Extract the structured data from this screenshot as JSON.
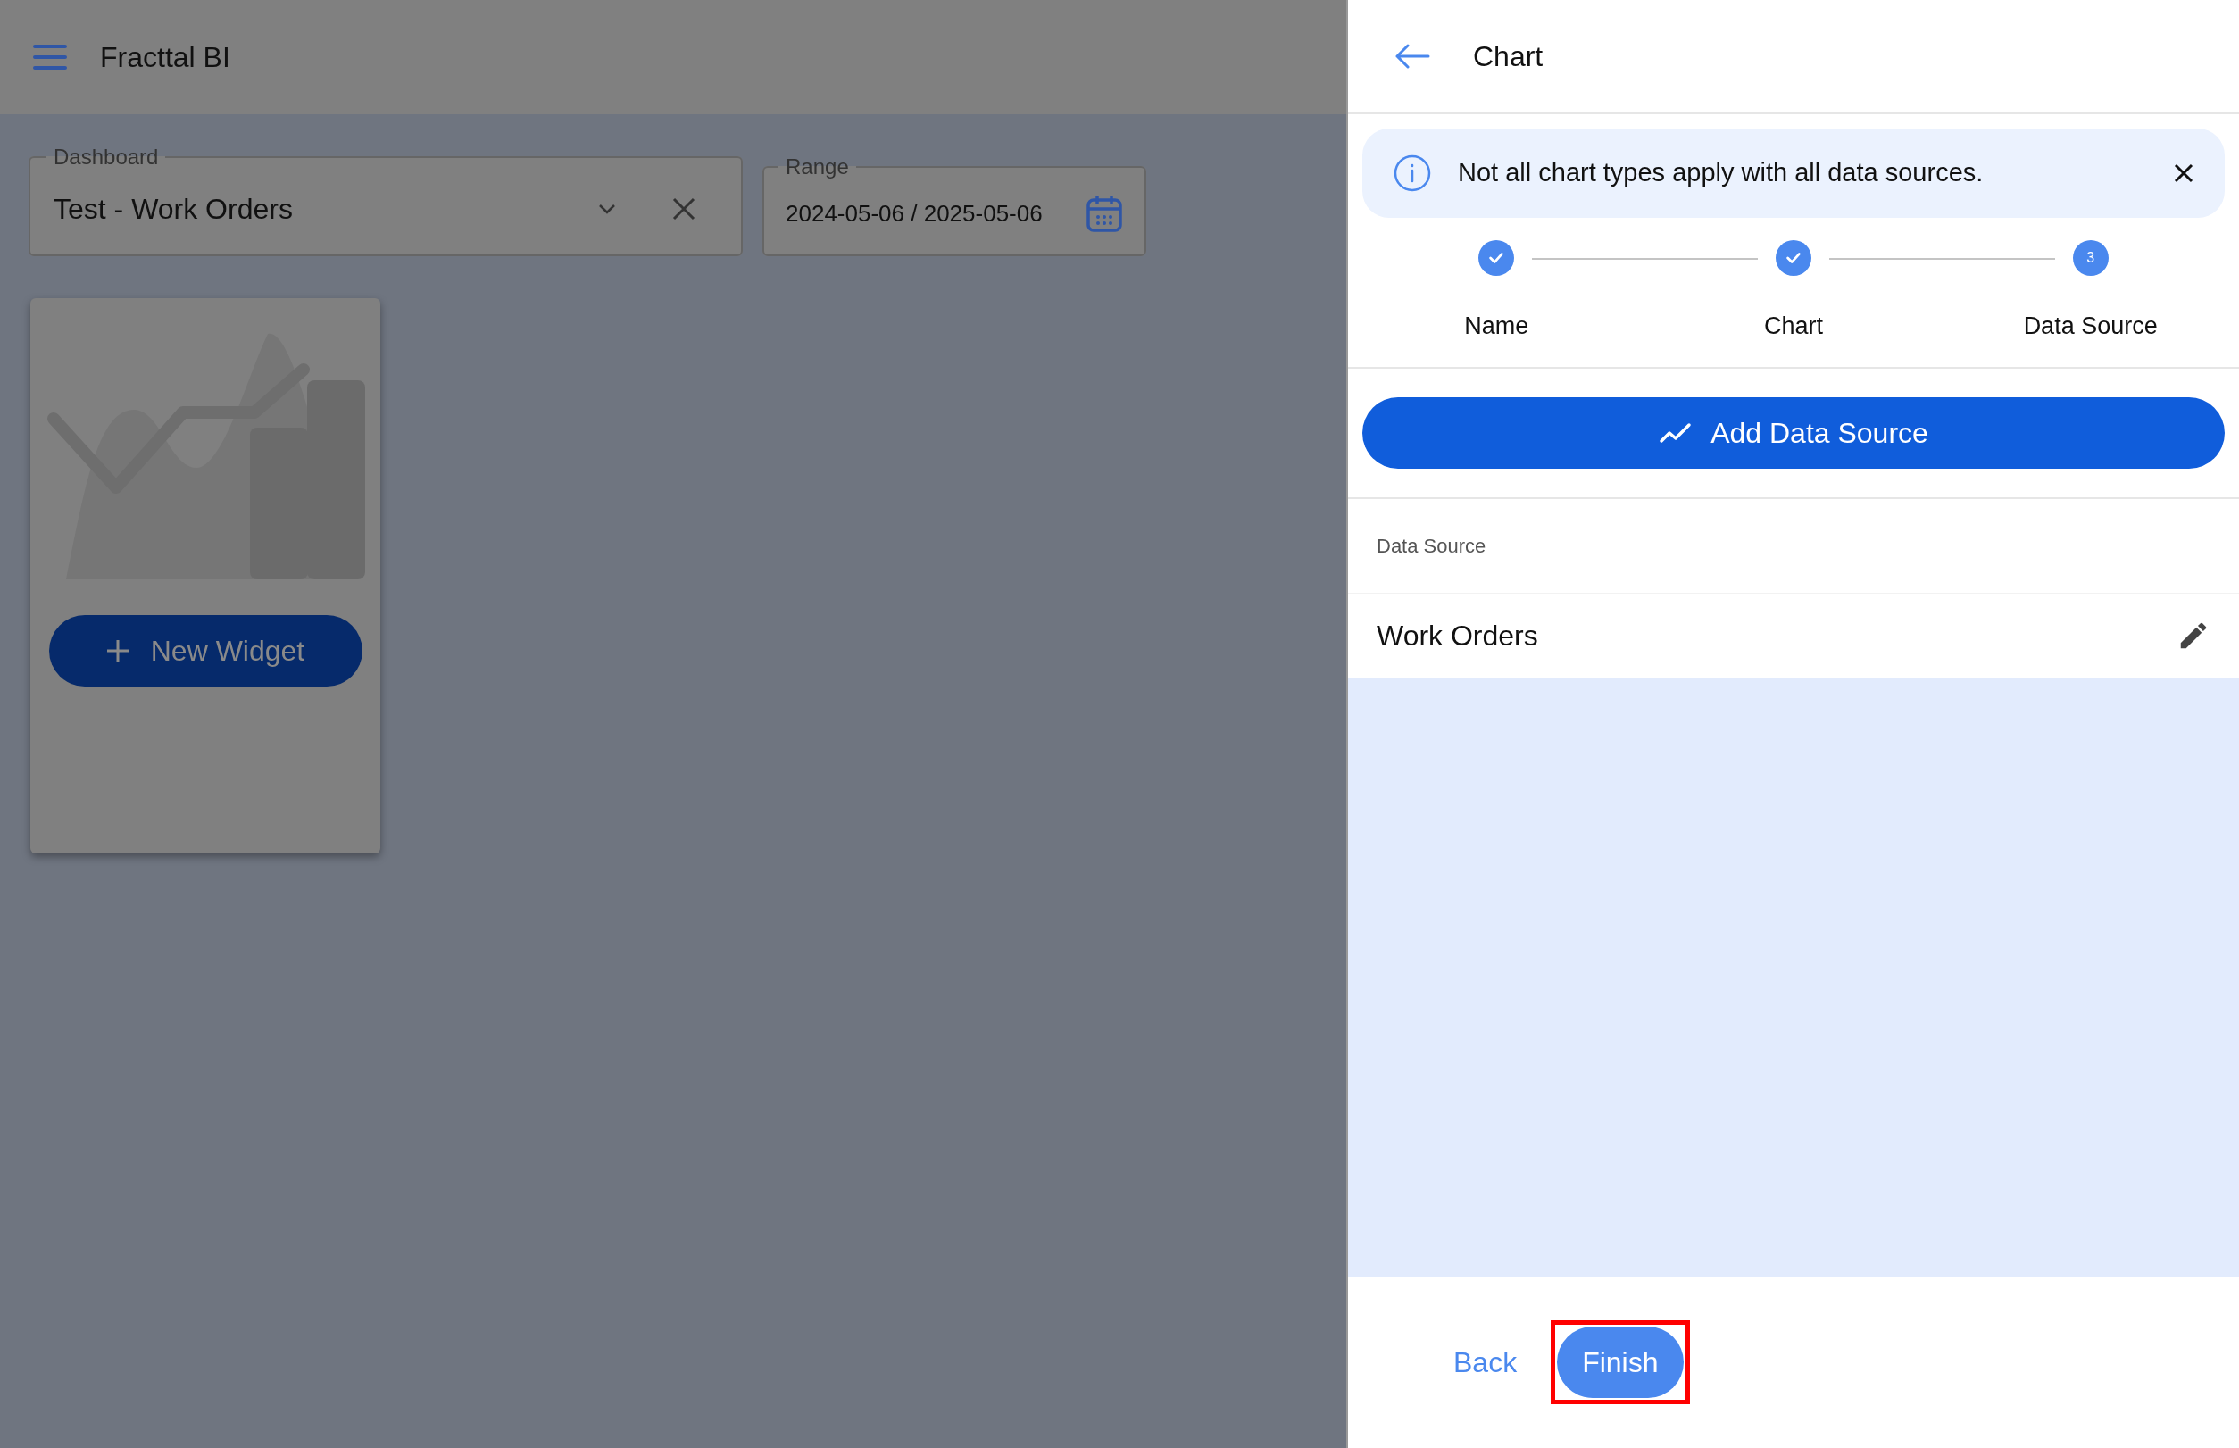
{
  "app_bar": {
    "title": "Fracttal BI"
  },
  "dashboard_field": {
    "label": "Dashboard",
    "value": "Test - Work Orders"
  },
  "range_field": {
    "label": "Range",
    "value": "2024-05-06 / 2025-05-06"
  },
  "widget_card": {
    "button": "New Widget"
  },
  "panel": {
    "title": "Chart",
    "alert": {
      "text": "Not all chart types apply with all data sources."
    },
    "steps": [
      {
        "label": "Name",
        "completed": true
      },
      {
        "label": "Chart",
        "completed": true
      },
      {
        "label": "Data Source",
        "completed": false,
        "number": "3"
      }
    ],
    "add_button": "Add Data Source",
    "section_label": "Data Source",
    "sources": [
      {
        "name": "Work Orders"
      }
    ],
    "footer": {
      "back": "Back",
      "finish": {
        "label": "Finish",
        "highlighted": true
      }
    }
  }
}
